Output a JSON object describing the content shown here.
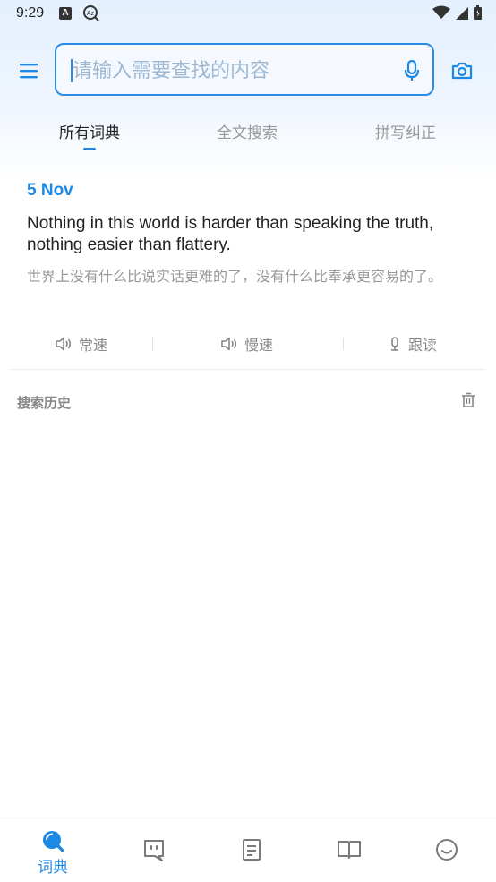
{
  "status_bar": {
    "time": "9:29"
  },
  "search": {
    "placeholder": "请输入需要查找的内容",
    "value": ""
  },
  "tabs": [
    {
      "label": "所有词典",
      "active": true
    },
    {
      "label": "全文搜索",
      "active": false
    },
    {
      "label": "拼写纠正",
      "active": false
    }
  ],
  "daily": {
    "date": "5 Nov",
    "english": "Nothing in this world is harder than speaking the truth, nothing easier than flattery.",
    "chinese": "世界上没有什么比说实话更难的了，没有什么比奉承更容易的了。"
  },
  "actions": [
    {
      "label": "常速",
      "icon": "speaker-icon"
    },
    {
      "label": "慢速",
      "icon": "speaker-icon"
    },
    {
      "label": "跟读",
      "icon": "mic-icon"
    }
  ],
  "history": {
    "title": "搜索历史"
  },
  "bottom_nav": [
    {
      "label": "词典",
      "icon": "dictionary-search-icon",
      "active": true
    },
    {
      "label": "",
      "icon": "chat-icon",
      "active": false
    },
    {
      "label": "",
      "icon": "notes-icon",
      "active": false
    },
    {
      "label": "",
      "icon": "book-icon",
      "active": false
    },
    {
      "label": "",
      "icon": "smiley-icon",
      "active": false
    }
  ],
  "colors": {
    "accent": "#1e88e5",
    "muted_text": "#999999"
  }
}
